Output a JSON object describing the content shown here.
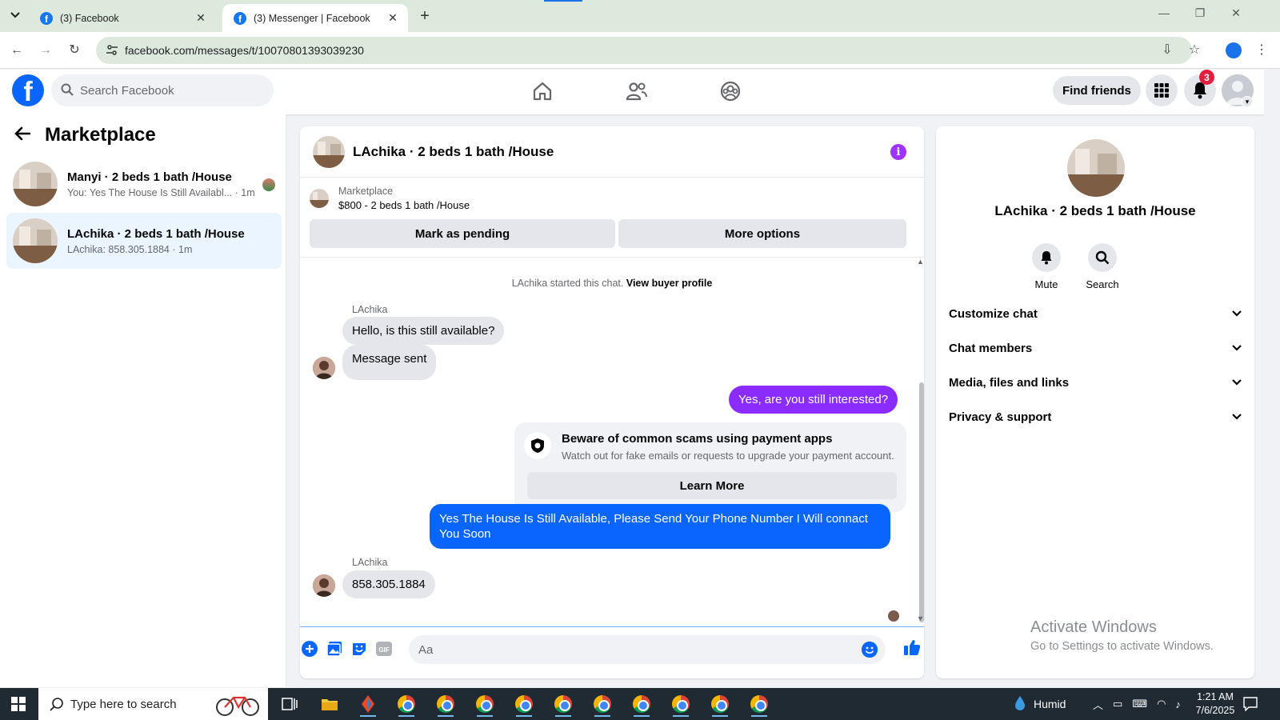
{
  "browser": {
    "tabs": [
      {
        "title": "(3) Facebook",
        "active": false
      },
      {
        "title": "(3) Messenger | Facebook",
        "active": true
      }
    ],
    "url": "facebook.com/messages/t/10070801393039230"
  },
  "header": {
    "search_placeholder": "Search Facebook",
    "find_friends_label": "Find friends",
    "notification_count": "3",
    "nav_icons": [
      "home-icon",
      "friends-icon",
      "groups-icon"
    ]
  },
  "sidebar": {
    "title": "Marketplace",
    "conversations": [
      {
        "name": "Manyi · 2 beds 1 bath /House",
        "preview": "You: Yes The House Is Still Availabl...",
        "time": "· 1m",
        "active": false
      },
      {
        "name": "LAchika · 2 beds 1 bath /House",
        "preview": "LAchika: 858.305.1884",
        "time": "· 1m",
        "active": true
      }
    ]
  },
  "chat": {
    "title": "LAchika · 2 beds 1 bath /House",
    "listing": {
      "source": "Marketplace",
      "title": "$800 - 2 beds 1 bath /House"
    },
    "mark_pending_label": "Mark as pending",
    "more_options_label": "More options",
    "system_note": "LAchika started this chat.",
    "view_buyer_profile": "View buyer profile",
    "messages": [
      {
        "sender_label": "LAchika",
        "text": "Hello, is this still available?",
        "direction": "in"
      },
      {
        "text": "Message sent",
        "direction": "in"
      },
      {
        "text": "Yes, are you still interested?",
        "direction": "out"
      },
      {
        "text": "Yes The House Is Still Available, Please Send Your Phone Number I Will connact You Soon",
        "direction": "out"
      },
      {
        "sender_label": "LAchika",
        "text": "858.305.1884",
        "direction": "in"
      }
    ],
    "scam_card": {
      "title": "Beware of common scams using payment apps",
      "body": "Watch out for fake emails or requests to upgrade your payment account.",
      "button": "Learn More"
    },
    "composer_placeholder": "Aa",
    "colors": {
      "accent_purple": "#a033ff",
      "outgoing_purple": "#8a2bff",
      "outgoing_blue": "#0866ff"
    }
  },
  "info_panel": {
    "name": "LAchika · 2 beds 1 bath /House",
    "actions": [
      "Mute",
      "Search"
    ],
    "sections": [
      "Customize chat",
      "Chat members",
      "Media, files and links",
      "Privacy & support"
    ]
  },
  "watermark": {
    "title": "Activate Windows",
    "subtitle": "Go to Settings to activate Windows."
  },
  "taskbar": {
    "search_placeholder": "Type here to search",
    "weather": "Humid",
    "time": "1:21 AM",
    "date": "7/6/2025"
  }
}
